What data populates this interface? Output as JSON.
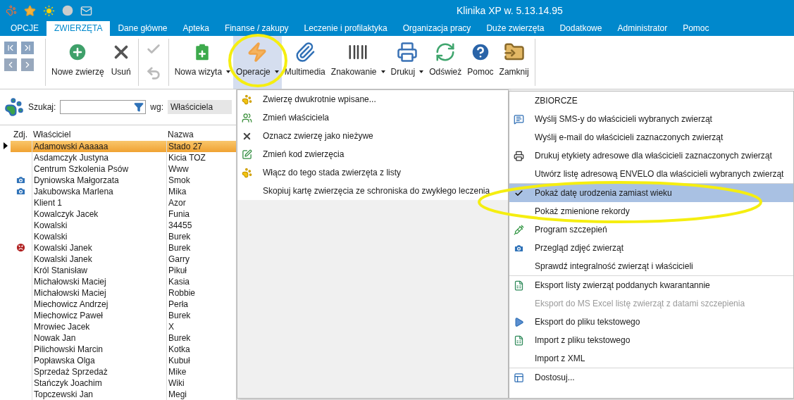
{
  "window": {
    "title": "Klinika XP w. 5.13.14.95"
  },
  "menu_tabs": [
    {
      "label": "OPCJE",
      "selected": false
    },
    {
      "label": "ZWIERZĘTA",
      "selected": true
    },
    {
      "label": "Dane główne",
      "selected": false
    },
    {
      "label": "Apteka",
      "selected": false
    },
    {
      "label": "Finanse / zakupy",
      "selected": false
    },
    {
      "label": "Leczenie i profilaktyka",
      "selected": false
    },
    {
      "label": "Organizacja pracy",
      "selected": false
    },
    {
      "label": "Duże zwierzęta",
      "selected": false
    },
    {
      "label": "Dodatkowe",
      "selected": false
    },
    {
      "label": "Administrator",
      "selected": false
    },
    {
      "label": "Pomoc",
      "selected": false
    }
  ],
  "ribbon": [
    {
      "kind": "add",
      "label": "Nowe zwierzę",
      "dropdown": false,
      "selected": false
    },
    {
      "kind": "delete",
      "label": "Usuń",
      "dropdown": false,
      "selected": false
    },
    {
      "kind": "pair",
      "disabled": true
    },
    {
      "kind": "visit",
      "label": "Nowa wizyta",
      "dropdown": true,
      "selected": false
    },
    {
      "kind": "operations",
      "label": "Operacje",
      "dropdown": true,
      "selected": true
    },
    {
      "kind": "media",
      "label": "Multimedia",
      "dropdown": false,
      "selected": false
    },
    {
      "kind": "marking",
      "label": "Znakowanie",
      "dropdown": true,
      "selected": false
    },
    {
      "kind": "print",
      "label": "Drukuj",
      "dropdown": true,
      "selected": false
    },
    {
      "kind": "refresh",
      "label": "Odśwież",
      "dropdown": false,
      "selected": false
    },
    {
      "kind": "help",
      "label": "Pomoc",
      "dropdown": false,
      "selected": false
    },
    {
      "kind": "close",
      "label": "Zamknij",
      "dropdown": false,
      "selected": false
    }
  ],
  "search": {
    "label": "Szukaj:",
    "by_label": "wg:",
    "by_value": "Właściciela"
  },
  "table": {
    "columns": [
      "Zdj.",
      "Właściciel",
      "Nazwa"
    ],
    "rows": [
      {
        "owner": "Adamowski Aaaaaa",
        "name": "Stado 27",
        "selected": true
      },
      {
        "owner": "Asdamczyk  Justyna",
        "name": "Kicia TOZ",
        "selected": false
      },
      {
        "owner": "Centrum Szkolenia Psów",
        "name": "Www",
        "selected": false
      },
      {
        "kind": "camera",
        "owner": "Dyniowska Małgorzata",
        "name": "Smok",
        "selected": false
      },
      {
        "kind": "camera",
        "owner": "Jakubowska Marlena",
        "name": "Mika",
        "selected": false
      },
      {
        "owner": "Klient 1",
        "name": "Azor",
        "selected": false
      },
      {
        "owner": "Kowalczyk Jacek",
        "name": "Funia",
        "selected": false
      },
      {
        "owner": "Kowalski",
        "name": "34455",
        "selected": false
      },
      {
        "owner": "Kowalski",
        "name": "Burek",
        "selected": false
      },
      {
        "kind": "biter",
        "owner": "Kowalski Janek",
        "name": "Burek",
        "selected": false
      },
      {
        "owner": "Kowalski Janek",
        "name": "Garry",
        "selected": false
      },
      {
        "owner": "Król Stanisław",
        "name": "Pikuł",
        "selected": false
      },
      {
        "owner": "Michałowski Maciej",
        "name": "Kasia",
        "selected": false
      },
      {
        "owner": "Michałowski Maciej",
        "name": "Robbie",
        "selected": false
      },
      {
        "owner": "Miechowicz Andrzej",
        "name": "Perła",
        "selected": false
      },
      {
        "owner": "Miechowicz Paweł",
        "name": "Burek",
        "selected": false
      },
      {
        "owner": "Mrowiec  Jacek",
        "name": "X",
        "selected": false
      },
      {
        "owner": "Nowak Jan",
        "name": "Burek",
        "selected": false
      },
      {
        "owner": "Pilichowski Marcin",
        "name": "Kotka",
        "selected": false
      },
      {
        "owner": "Popławska Olga",
        "name": "Kubuł",
        "selected": false
      },
      {
        "owner": "Sprzedaż Sprzedaż",
        "name": "Mike",
        "selected": false
      },
      {
        "owner": "Stańczyk Joachim",
        "name": "Wiki",
        "selected": false
      },
      {
        "owner": "Topczewski Jan",
        "name": "Megi",
        "selected": false
      }
    ]
  },
  "operations_menu": [
    {
      "kind": "paws",
      "label": "Zwierzę dwukrotnie wpisane..."
    },
    {
      "kind": "owners",
      "label": "Zmień właściciela"
    },
    {
      "kind": "cross",
      "label": "Oznacz zwierzę jako nieżywe"
    },
    {
      "kind": "edit",
      "label": "Zmień kod zwierzęcia"
    },
    {
      "kind": "paws",
      "label": "Włącz do tego stada zwierzęta z listy"
    },
    {
      "kind": "plain",
      "label": "Skopiuj kartę zwierzęcia ze schroniska do zwykłego leczenia"
    }
  ],
  "bulk_menu": [
    {
      "kind": "plain",
      "label": "ZBIORCZE",
      "checked": false,
      "highlighted": false,
      "disabled": false,
      "separator_before": false
    },
    {
      "kind": "sms",
      "label": "Wyślij SMS-y do właścicieli wybranych zwierząt",
      "checked": false,
      "highlighted": false,
      "disabled": false,
      "separator_before": false
    },
    {
      "kind": "plain",
      "label": "Wyślij e-mail do właścicieli zaznaczonych zwierząt",
      "checked": false,
      "highlighted": false,
      "disabled": false,
      "separator_before": false
    },
    {
      "kind": "printer",
      "label": "Drukuj etykiety adresowe dla właścicieli zaznaczonych zwierząt",
      "checked": false,
      "highlighted": false,
      "disabled": false,
      "separator_before": false
    },
    {
      "kind": "plain",
      "label": "Utwórz listę adresową ENVELO dla właścicieli wybranych zwierząt",
      "checked": false,
      "highlighted": false,
      "disabled": false,
      "separator_before": false
    },
    {
      "kind": "plain",
      "label": "Pokaż datę urodzenia zamiast wieku",
      "checked": true,
      "highlighted": true,
      "disabled": false,
      "separator_before": true
    },
    {
      "kind": "plain",
      "label": "Pokaż zmienione rekordy",
      "checked": false,
      "highlighted": false,
      "disabled": false,
      "separator_before": false
    },
    {
      "kind": "syringe",
      "label": "Program szczepień",
      "checked": false,
      "highlighted": false,
      "disabled": false,
      "separator_before": false
    },
    {
      "kind": "camera",
      "label": "Przegląd zdjęć zwierząt",
      "checked": false,
      "highlighted": false,
      "disabled": false,
      "separator_before": false
    },
    {
      "kind": "plain",
      "label": "Sprawdź integralność zwierząt i właścicieli",
      "checked": false,
      "highlighted": false,
      "disabled": false,
      "separator_before": false
    },
    {
      "kind": "sheet",
      "label": "Eksport listy zwierząt poddanych kwarantannie",
      "checked": false,
      "highlighted": false,
      "disabled": false,
      "separator_before": true
    },
    {
      "kind": "plain",
      "label": "Eksport do MS Excel listę zwierząt z datami szczepienia",
      "checked": false,
      "highlighted": false,
      "disabled": true,
      "separator_before": false
    },
    {
      "kind": "play",
      "label": "Eksport do pliku tekstowego",
      "checked": false,
      "highlighted": false,
      "disabled": false,
      "separator_before": false
    },
    {
      "kind": "sheet",
      "label": "Import z pliku tekstowego",
      "checked": false,
      "highlighted": false,
      "disabled": false,
      "separator_before": false
    },
    {
      "kind": "plain",
      "label": "Import z XML",
      "checked": false,
      "highlighted": false,
      "disabled": false,
      "separator_before": false
    },
    {
      "kind": "layout",
      "label": "Dostosuj...",
      "checked": false,
      "highlighted": false,
      "disabled": false,
      "separator_before": true
    }
  ]
}
